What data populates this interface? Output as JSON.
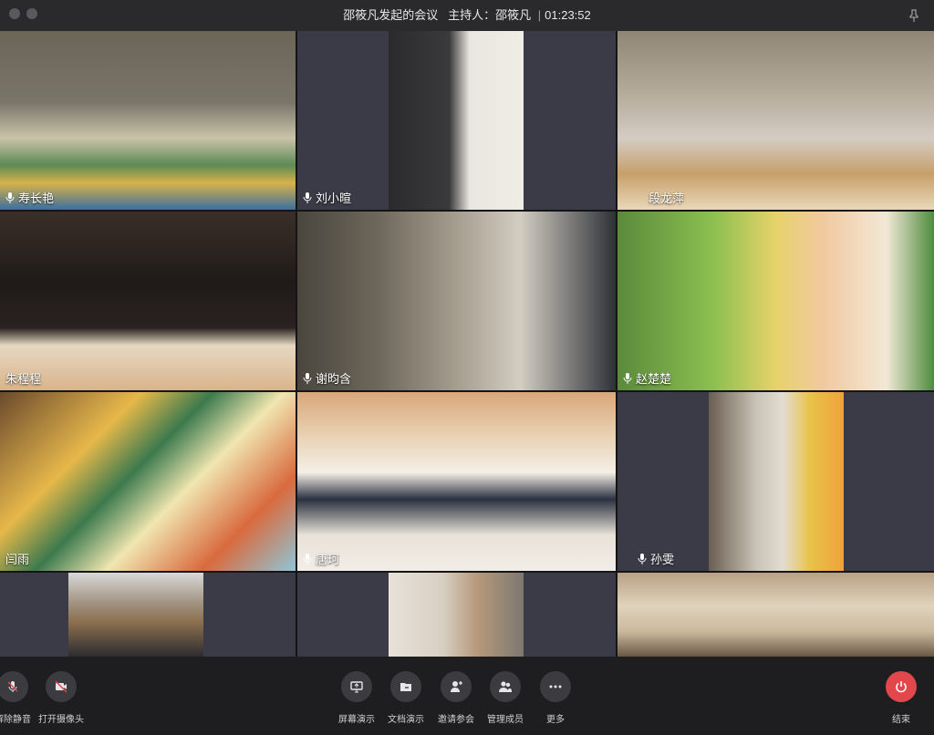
{
  "window": {
    "title": "邵筱凡发起的会议",
    "host_label": "主持人：",
    "host_name": "邵筱凡",
    "timer": "01:23:52"
  },
  "participants": [
    {
      "name": "寿长艳",
      "muted": true
    },
    {
      "name": "刘小暄",
      "muted": true
    },
    {
      "name": "段龙萍",
      "muted": false
    },
    {
      "name": "朱程程",
      "muted": false
    },
    {
      "name": "谢昀含",
      "muted": true
    },
    {
      "name": "赵楚楚",
      "muted": true
    },
    {
      "name": "闫雨",
      "muted": false
    },
    {
      "name": "唐珂",
      "muted": true
    },
    {
      "name": "孙雯",
      "muted": true
    }
  ],
  "toolbar": {
    "unmute": "解除静音",
    "camera": "打开摄像头",
    "share_screen": "屏幕演示",
    "share_doc": "文档演示",
    "invite": "邀请参会",
    "manage": "管理成员",
    "more": "更多",
    "end": "结束"
  },
  "colors": {
    "end_button": "#e2474b",
    "background": "#1f1f22",
    "tile_placeholder": "#3b3b47"
  }
}
